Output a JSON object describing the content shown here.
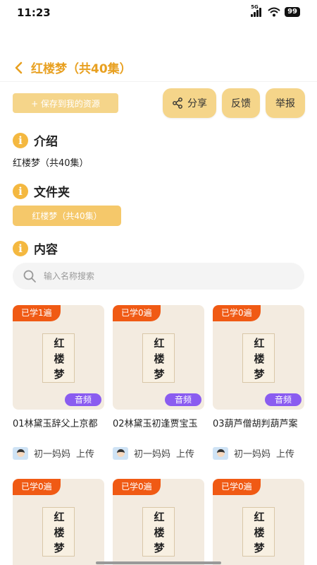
{
  "status": {
    "time": "11:23",
    "network": "5G",
    "battery": "99"
  },
  "nav": {
    "title": "红楼梦（共40集）"
  },
  "actions": {
    "save_label": "+ 保存到我的资源",
    "share_label": "分享",
    "feedback_label": "反馈",
    "report_label": "举报"
  },
  "sections": {
    "intro_title": "介绍",
    "intro_text": "红楼梦（共40集）",
    "folder_title": "文件夹",
    "folder_chip": "红楼梦（共40集）",
    "content_title": "内容"
  },
  "search": {
    "placeholder": "输入名称搜索"
  },
  "cover_text": "红楼梦",
  "items": [
    {
      "badge": "已学1遍",
      "tag": "音频",
      "title": "01林黛玉辞父上京都",
      "uploader": "初一妈妈",
      "upload_label": "上传"
    },
    {
      "badge": "已学0遍",
      "tag": "音频",
      "title": "02林黛玉初逢贾宝玉",
      "uploader": "初一妈妈",
      "upload_label": "上传"
    },
    {
      "badge": "已学0遍",
      "tag": "音频",
      "title": "03葫芦僧胡判葫芦案",
      "uploader": "初一妈妈",
      "upload_label": "上传"
    },
    {
      "badge": "已学0遍"
    },
    {
      "badge": "已学0遍"
    },
    {
      "badge": "已学0遍"
    }
  ],
  "colors": {
    "accent": "#e8a020",
    "button_bg": "#f5d58a",
    "badge": "#f05a14",
    "audio_tag": "#8a5cf0"
  }
}
